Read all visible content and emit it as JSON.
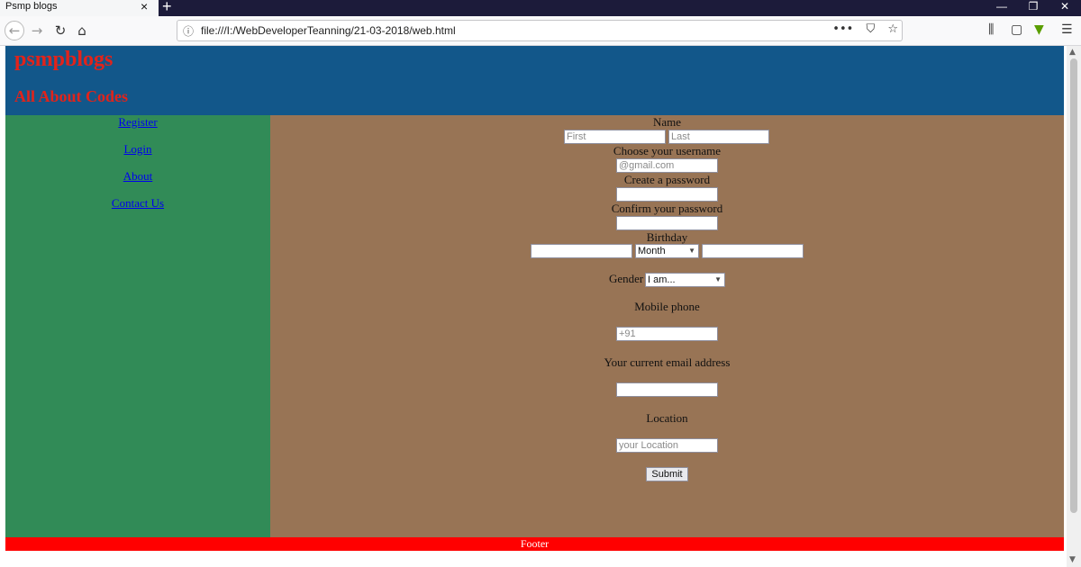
{
  "browser": {
    "tab_title": "Psmp blogs",
    "url": "file:///I:/WebDeveloperTeanning/21-03-2018/web.html"
  },
  "header": {
    "title": "psmpblogs",
    "subtitle": "All About Codes"
  },
  "sidebar": {
    "links": [
      "Register",
      "Login",
      "About",
      "Contact Us"
    ]
  },
  "form": {
    "name_label": "Name",
    "first_placeholder": "First",
    "last_placeholder": "Last",
    "username_label": "Choose your username",
    "username_placeholder": "@gmail.com",
    "password_label": "Create a password",
    "confirm_label": "Confirm your password",
    "birthday_label": "Birthday",
    "month_selected": "Month",
    "gender_label": "Gender",
    "gender_selected": "I am...",
    "mobile_label": "Mobile phone",
    "mobile_placeholder": "+91",
    "email_label": "Your current email address",
    "location_label": "Location",
    "location_placeholder": "your Location",
    "submit_label": "Submit"
  },
  "footer": {
    "text": "Footer"
  },
  "colors": {
    "header_bg": "#12578a",
    "title_text": "#e2231a",
    "sidebar_bg": "#318b57",
    "main_bg": "#987455",
    "footer_bg": "#ff0000"
  }
}
